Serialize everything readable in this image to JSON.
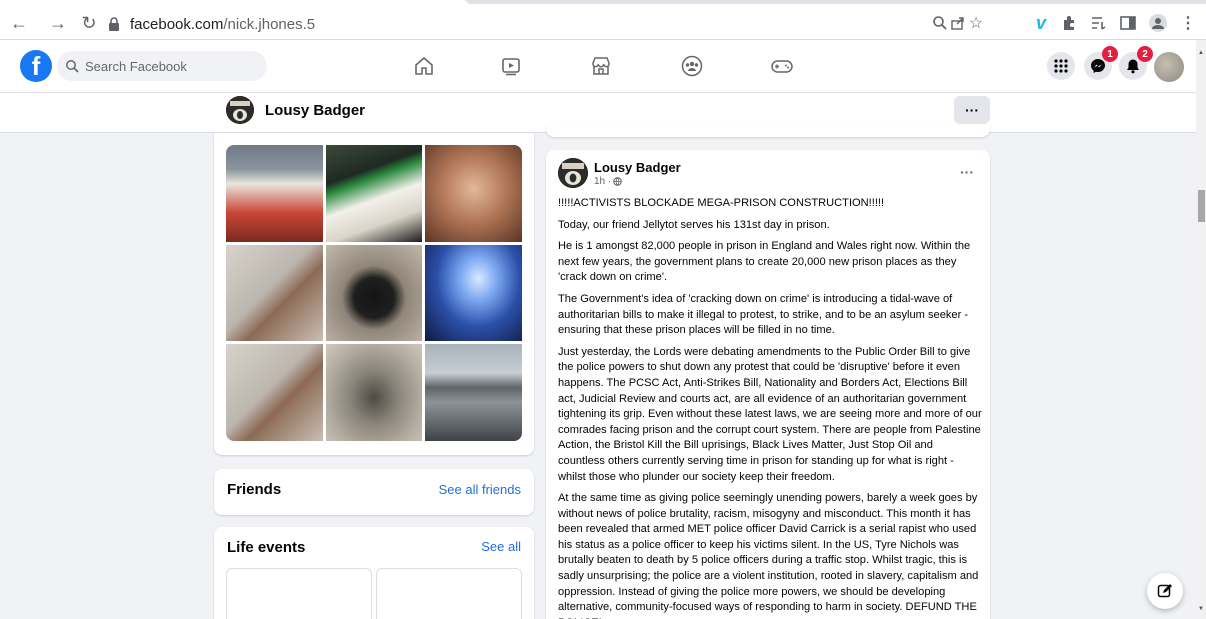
{
  "browser": {
    "url_host": "facebook.com",
    "url_path": "/nick.jhones.5",
    "icons": [
      "back-icon",
      "forward-icon",
      "reload-icon",
      "lock-icon",
      "zoom-icon",
      "share-icon",
      "star-icon",
      "vimeo-icon",
      "extensions-icon",
      "reading-list-icon",
      "side-panel-icon",
      "profile-icon",
      "menu-icon"
    ]
  },
  "fb_nav": {
    "search_placeholder": "Search Facebook",
    "tabs": [
      "home-icon",
      "watch-icon",
      "marketplace-icon",
      "groups-icon",
      "gaming-icon"
    ],
    "messenger_badge": "1",
    "notifications_badge": "2"
  },
  "profile_header": {
    "name": "Lousy Badger",
    "more_label": "···"
  },
  "left": {
    "friends_title": "Friends",
    "friends_link": "See all friends",
    "life_events_title": "Life events",
    "life_events_link": "See all"
  },
  "post": {
    "author": "Lousy Badger",
    "time": "1h ·",
    "more_label": "···",
    "paragraphs": [
      "!!!!!ACTIVISTS BLOCKADE MEGA-PRISON CONSTRUCTION!!!!!",
      "Today, our friend Jellytot serves his 131st day in prison.",
      "He is 1 amongst 82,000 people in prison in England and Wales right now. Within the next few years, the government plans to create 20,000 new prison places as they 'crack down on crime'.",
      "The Government's idea of 'cracking down on crime' is introducing a tidal-wave of authoritarian bills to make it illegal to protest, to strike, and to be an asylum seeker - ensuring that these prison places will be filled in no time.",
      "Just yesterday, the Lords were debating amendments to the Public Order Bill to give the police powers to shut down any protest that could be 'disruptive' before it even happens. The PCSC Act, Anti-Strikes Bill, Nationality and Borders Act, Elections Bill act, Judicial Review and courts act, are all evidence of an authoritarian government tightening its grip. Even without these latest laws, we are seeing more and more of our comrades facing prison and the corrupt court system. There are people from Palestine Action, the Bristol Kill the Bill uprisings, Black Lives Matter, Just Stop Oil and countless others currently serving time in prison for standing up for what is right - whilst those who plunder our society keep their freedom.",
      "At the same time as giving police seemingly unending powers, barely a week goes by without news of police brutality, racism, misogyny and misconduct. This month it has been revealed that armed MET police officer David Carrick is a serial rapist who used his status as a police officer to keep his victims silent. In the US, Tyre Nichols was brutally beaten to death by 5 police officers during a traffic stop. Whilst tragic, this is sadly unsurprising; the police are a violent institution, rooted in slavery, capitalism and oppression. Instead of giving the police more powers, we should be developing alternative, community-focused ways of responding to harm in society. DEFUND THE POLICE!"
    ]
  },
  "colors": {
    "fb_blue": "#1877f2",
    "link_blue": "#216fdb",
    "badge_red": "#e41e3f",
    "page_bg": "#f0f2f5"
  }
}
